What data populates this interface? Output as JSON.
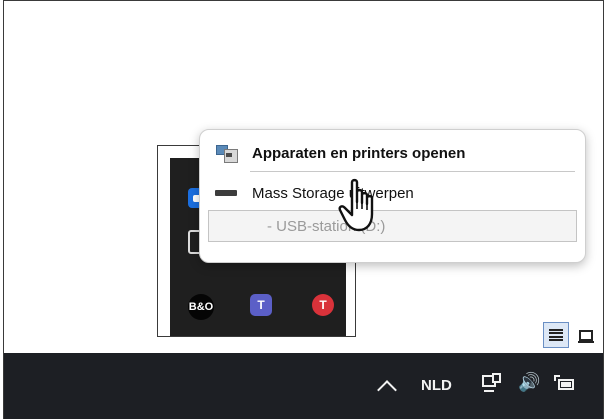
{
  "context_menu": {
    "items": [
      {
        "label": "Apparaten en printers openen",
        "icon": "devices-printers-icon",
        "bold": true
      },
      {
        "label": "Mass Storage uitwerpen",
        "icon": "drive-icon",
        "bold": false
      },
      {
        "label": "-   USB-station (D:)",
        "icon": "",
        "disabled": true
      }
    ]
  },
  "tray_overflow": {
    "icons": [
      "zoom-icon",
      "usb-device-icon",
      "security-check-icon",
      "bluetooth-icon",
      "bang-olufsen-icon",
      "teams-icon",
      "red-app-icon"
    ],
    "bo_text": "B&O",
    "teams_text": "T",
    "red_text": "T"
  },
  "taskbar": {
    "language": "NLD",
    "volume_glyph": "🔊",
    "colors": {
      "background": "#1d1f24",
      "text": "#f2f2f2"
    }
  },
  "view_toggles": {
    "selected": "list"
  }
}
